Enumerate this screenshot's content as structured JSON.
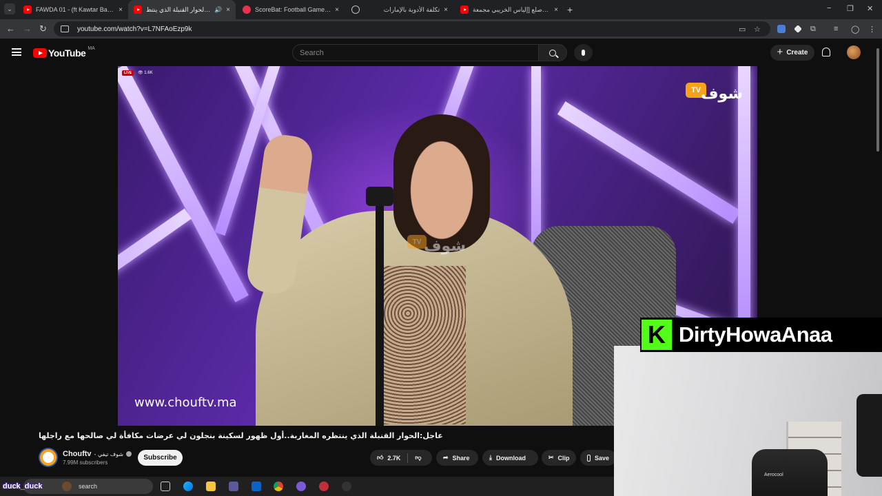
{
  "browser": {
    "tabs": [
      {
        "title": "FAWDA 01 - (ft Kawtar Bamo &",
        "favicon": "youtube-icon",
        "active": false
      },
      {
        "title": "عاجل:الحوار القنبلة الذي ينتظ",
        "favicon": "youtube-icon",
        "active": true,
        "extra": "🔊"
      },
      {
        "title": "ScoreBat: Football Games Toda",
        "favicon": "scorebat-icon",
        "active": false
      },
      {
        "title": "تكلفة الأدوية بالإمارات",
        "favicon": "globe-icon",
        "active": false
      },
      {
        "title": "هل أصلع [إلياس الخريبي مجمعة",
        "favicon": "youtube-icon",
        "active": false
      }
    ],
    "close_glyph": "×",
    "new_tab_glyph": "+",
    "window_controls": [
      "−",
      "❐",
      "✕"
    ],
    "url": "youtube.com/watch?v=L7NFAoEzp9k"
  },
  "youtube": {
    "logo_text": "YouTube",
    "country_code": "MA",
    "search_placeholder": "Search",
    "create_label": "Create"
  },
  "player": {
    "live_label": "LIVE",
    "viewers": "👁 1.6K",
    "watermark_url": "www.chouftv.ma",
    "brand_tv": "TV",
    "brand_arabic": "شوف"
  },
  "video": {
    "title": "عاجل:الحوار القنبلة الذي ينتظره المغاربة..أول ظهور لسكينة بنجلون لي عرضات مكافأة لي صالحها مع راجلها",
    "channel_name": "Chouftv",
    "channel_name_ar": "- شوف تيفي",
    "subscribers": "7.99M subscribers",
    "subscribe_label": "Subscribe",
    "likes": "2.7K",
    "share_label": "Share",
    "download_label": "Download",
    "clip_label": "Clip",
    "save_label": "Save"
  },
  "overlay": {
    "kick_letter": "K",
    "streamer_name": "DirtyHowaAnaa",
    "chair_brand": "Aerocool",
    "duck_text": "duck_duck"
  },
  "taskbar": {
    "search_label": "search"
  },
  "colors": {
    "youtube_red": "#ff0000",
    "kick_green": "#53fc18",
    "chouf_orange": "#f7a21b"
  }
}
